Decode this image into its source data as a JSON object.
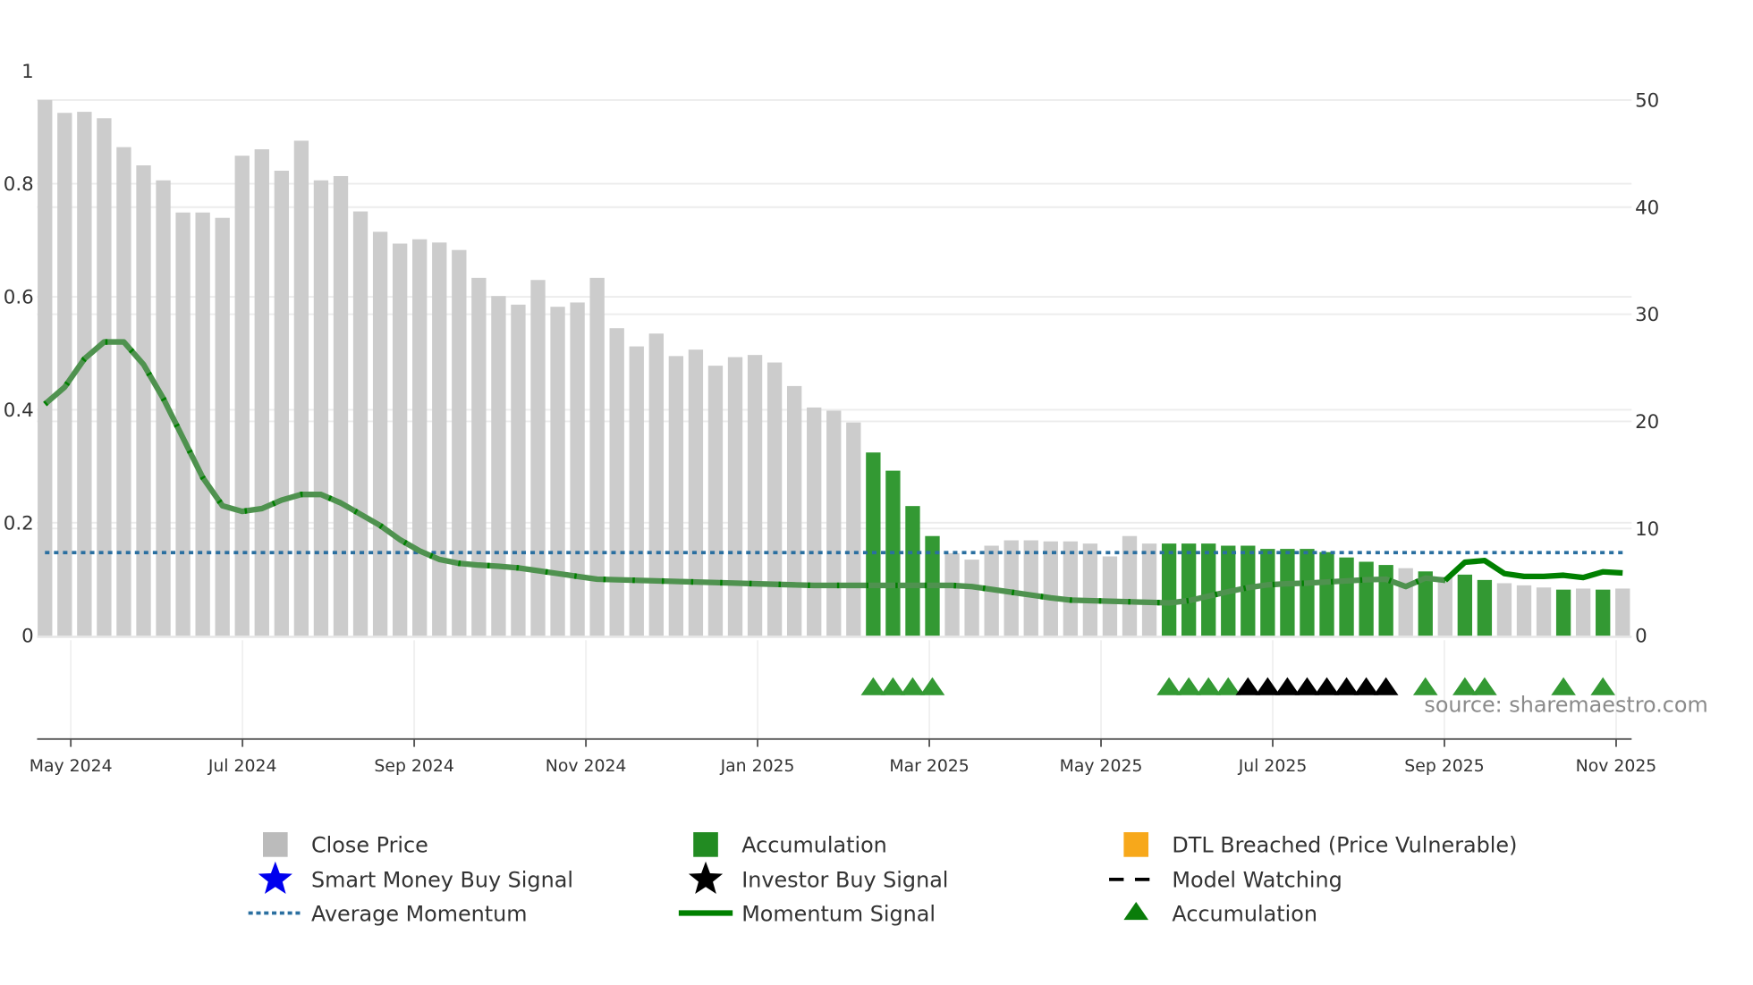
{
  "chart_data": {
    "type": "bar",
    "title": "",
    "left_axis": {
      "range": [
        0,
        1
      ],
      "ticks": [
        "0",
        "0.2",
        "0.4",
        "0.6",
        "0.8",
        "1"
      ]
    },
    "right_axis": {
      "range": [
        0,
        50
      ],
      "ticks": [
        "0",
        "10",
        "20",
        "30",
        "40",
        "50"
      ]
    },
    "x_ticks": [
      "May 2024",
      "Jul 2024",
      "Sep 2024",
      "Nov 2024",
      "Jan 2025",
      "Mar 2025",
      "May 2025",
      "Jul 2025",
      "Sep 2025",
      "Nov 2025"
    ],
    "bar_start": "2024-04-22",
    "bar_interval_days": 7,
    "close_price": [
      50.0,
      48.8,
      48.9,
      48.3,
      45.6,
      43.9,
      42.5,
      39.5,
      39.5,
      39.0,
      44.8,
      45.4,
      43.4,
      46.2,
      42.5,
      42.9,
      39.6,
      37.7,
      36.6,
      37.0,
      36.7,
      36.0,
      33.4,
      31.7,
      30.9,
      33.2,
      30.7,
      31.1,
      33.4,
      28.7,
      27.0,
      28.2,
      26.1,
      26.7,
      25.2,
      26.0,
      26.2,
      25.5,
      23.3,
      21.3,
      21.0,
      19.9,
      17.1,
      15.4,
      12.1,
      9.3,
      7.7,
      7.1,
      8.4,
      8.9,
      8.9,
      8.8,
      8.8,
      8.6,
      7.4,
      9.3,
      8.6,
      8.6,
      8.6,
      8.6,
      8.4,
      8.4,
      8.1,
      8.1,
      8.1,
      7.8,
      7.3,
      6.9,
      6.6,
      6.3,
      6.0,
      5.5,
      5.7,
      5.2,
      4.9,
      4.7,
      4.5,
      4.3,
      4.4,
      4.3,
      4.4
    ],
    "accumulation_bars": [
      43,
      44,
      45,
      46,
      58,
      59,
      60,
      61,
      62,
      63,
      64,
      65,
      66,
      67,
      68,
      69,
      71,
      73,
      74,
      78,
      80
    ],
    "momentum_signal": [
      0.41,
      0.44,
      0.49,
      0.52,
      0.52,
      0.48,
      0.42,
      0.35,
      0.28,
      0.23,
      0.22,
      0.225,
      0.24,
      0.25,
      0.25,
      0.235,
      0.215,
      0.195,
      0.17,
      0.15,
      0.135,
      0.128,
      0.125,
      0.123,
      0.12,
      0.115,
      0.11,
      0.105,
      0.1,
      0.099,
      0.098,
      0.097,
      0.096,
      0.095,
      0.094,
      0.093,
      0.092,
      0.091,
      0.09,
      0.089,
      0.089,
      0.089,
      0.089,
      0.089,
      0.089,
      0.089,
      0.089,
      0.087,
      0.082,
      0.077,
      0.072,
      0.067,
      0.063,
      0.062,
      0.061,
      0.06,
      0.059,
      0.058,
      0.062,
      0.07,
      0.078,
      0.085,
      0.09,
      0.092,
      0.093,
      0.095,
      0.097,
      0.099,
      0.1,
      0.087,
      0.102,
      0.098,
      0.13,
      0.133,
      0.11,
      0.105,
      0.105,
      0.107,
      0.103,
      0.113,
      0.111
    ],
    "model_watching_until_bar": 72,
    "average_momentum": 0.147,
    "accumulation_markers": [
      43,
      44,
      45,
      46,
      58,
      59,
      60,
      61,
      71,
      73,
      74,
      78,
      80
    ],
    "investor_buy_markers": [
      62,
      63,
      64,
      65,
      66,
      67,
      68,
      69
    ],
    "legend_placement": "bottom",
    "colors": {
      "close_price": "#cccccc",
      "accumulation": "#339933",
      "dtl": "#f7a81b",
      "smart_money": "#0000ee",
      "investor": "#000000",
      "avg_momentum": "#2a6fa0",
      "momentum": "#008000",
      "momentum_watch": "#4f924f",
      "grid": "#ececec"
    }
  },
  "source": "source: sharemaestro.com",
  "legend": [
    {
      "label": "Close Price",
      "icon": "square-gray"
    },
    {
      "label": "Accumulation",
      "icon": "square-green"
    },
    {
      "label": "DTL Breached (Price Vulnerable)",
      "icon": "square-orange"
    },
    {
      "label": "Smart Money Buy Signal",
      "icon": "star-blue"
    },
    {
      "label": "Investor Buy Signal",
      "icon": "star-black"
    },
    {
      "label": "Model Watching",
      "icon": "dashed-line-black"
    },
    {
      "label": "Average Momentum",
      "icon": "dotted-line-blue"
    },
    {
      "label": "Momentum Signal",
      "icon": "solid-line-green"
    },
    {
      "label": "Accumulation",
      "icon": "triangle-green"
    }
  ]
}
